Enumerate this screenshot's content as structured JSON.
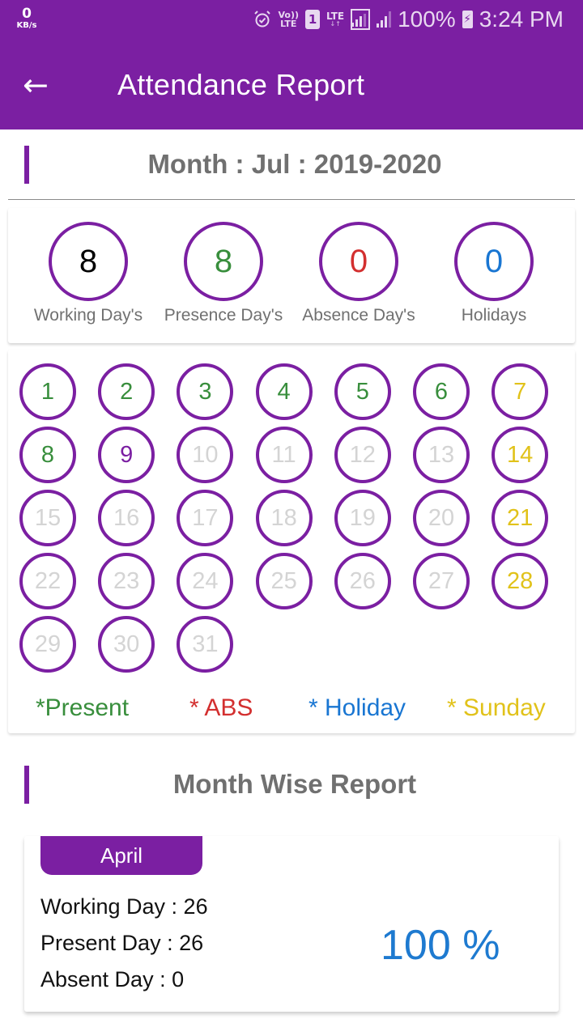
{
  "status_bar": {
    "net_speed_value": "0",
    "net_speed_unit": "KB/s",
    "volte_top": "Vo))",
    "volte_bottom": "LTE",
    "sim_slot": "1",
    "lte_label": "LTE",
    "lte_arrows": "↓↑",
    "battery_percent": "100%",
    "battery_glyph": "⚡",
    "time": "3:24 PM"
  },
  "app_bar": {
    "back_glyph": "←",
    "title": "Attendance Report"
  },
  "month_header": {
    "title": "Month : Jul : 2019-2020"
  },
  "summary": {
    "items": [
      {
        "value": "8",
        "label": "Working Day's",
        "color": "#000000"
      },
      {
        "value": "8",
        "label": "Presence Day's",
        "color": "#388e3c"
      },
      {
        "value": "0",
        "label": "Absence Day's",
        "color": "#d32f2f"
      },
      {
        "value": "0",
        "label": "Holidays",
        "color": "#1976d2"
      }
    ]
  },
  "calendar": {
    "status_colors": {
      "present": "#388e3c",
      "working": "#7b1fa2",
      "sunday": "#e1c21a",
      "future": "#d4d4d4"
    },
    "days": [
      {
        "day": "1",
        "status": "present"
      },
      {
        "day": "2",
        "status": "present"
      },
      {
        "day": "3",
        "status": "present"
      },
      {
        "day": "4",
        "status": "present"
      },
      {
        "day": "5",
        "status": "present"
      },
      {
        "day": "6",
        "status": "present"
      },
      {
        "day": "7",
        "status": "sunday"
      },
      {
        "day": "8",
        "status": "present"
      },
      {
        "day": "9",
        "status": "working"
      },
      {
        "day": "10",
        "status": "future"
      },
      {
        "day": "11",
        "status": "future"
      },
      {
        "day": "12",
        "status": "future"
      },
      {
        "day": "13",
        "status": "future"
      },
      {
        "day": "14",
        "status": "sunday"
      },
      {
        "day": "15",
        "status": "future"
      },
      {
        "day": "16",
        "status": "future"
      },
      {
        "day": "17",
        "status": "future"
      },
      {
        "day": "18",
        "status": "future"
      },
      {
        "day": "19",
        "status": "future"
      },
      {
        "day": "20",
        "status": "future"
      },
      {
        "day": "21",
        "status": "sunday"
      },
      {
        "day": "22",
        "status": "future"
      },
      {
        "day": "23",
        "status": "future"
      },
      {
        "day": "24",
        "status": "future"
      },
      {
        "day": "25",
        "status": "future"
      },
      {
        "day": "26",
        "status": "future"
      },
      {
        "day": "27",
        "status": "future"
      },
      {
        "day": "28",
        "status": "sunday"
      },
      {
        "day": "29",
        "status": "future"
      },
      {
        "day": "30",
        "status": "future"
      },
      {
        "day": "31",
        "status": "future"
      }
    ],
    "legend": [
      {
        "label": "*Present",
        "color": "#388e3c"
      },
      {
        "label": "* ABS",
        "color": "#d32f2f"
      },
      {
        "label": "* Holiday",
        "color": "#1976d2"
      },
      {
        "label": "* Sunday",
        "color": "#e1c21a"
      }
    ]
  },
  "month_wise": {
    "title": "Month Wise Report",
    "cards": [
      {
        "month": "April",
        "working_day": "Working Day : 26",
        "present_day": "Present Day : 26",
        "absent_day": "Absent Day : 0",
        "percent": "100 %"
      }
    ]
  },
  "theme": {
    "primary": "#7b1fa2",
    "percent_color": "#1e7ad0"
  }
}
